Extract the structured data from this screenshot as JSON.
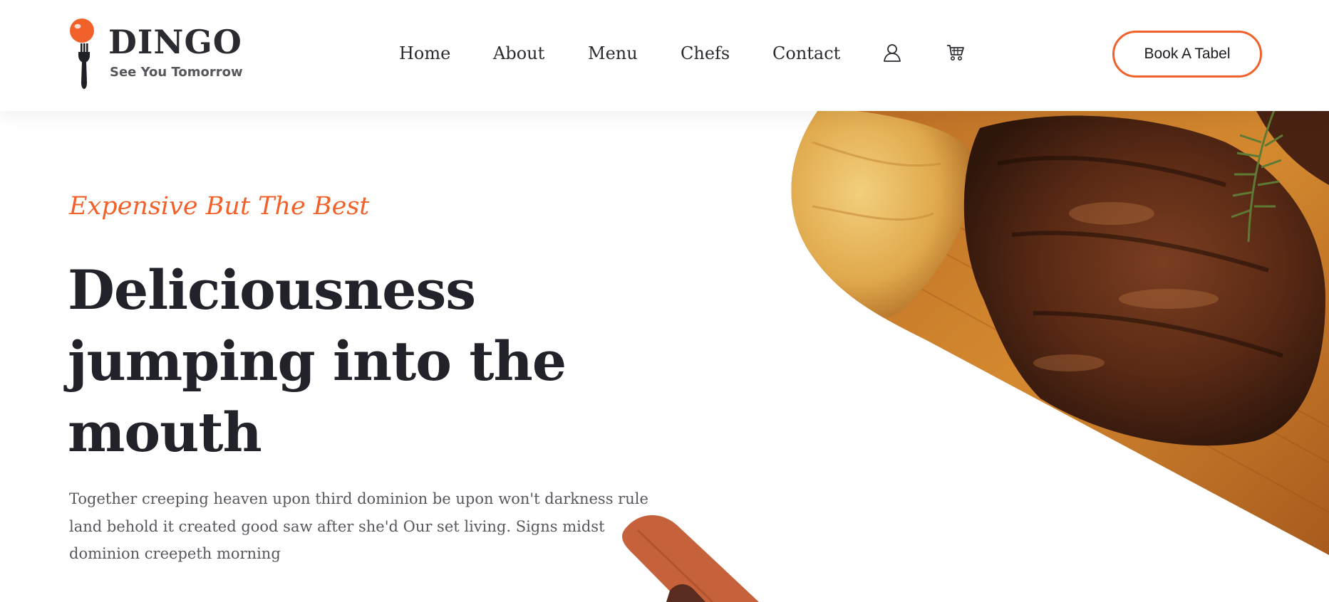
{
  "header": {
    "logo": {
      "name": "DINGO",
      "tagline": "See You Tomorrow"
    },
    "nav": [
      {
        "label": "Home"
      },
      {
        "label": "About"
      },
      {
        "label": "Menu"
      },
      {
        "label": "Chefs"
      },
      {
        "label": "Contact"
      }
    ],
    "icons": {
      "account": "user-icon",
      "cart": "cart-icon"
    },
    "cta_label": "Book A Tabel"
  },
  "hero": {
    "subtitle": "Expensive But The Best",
    "headline_lines": [
      "Deliciousness",
      "jumping into the",
      "mouth"
    ],
    "body": "Together creeping heaven upon third dominion be upon won't darkness rule land behold it created good saw after she'd Our set living. Signs midst dominion creepeth morning",
    "image": "grilled-steak-on-board"
  },
  "colors": {
    "accent": "#f16129",
    "heading": "#22232a",
    "body": "#56585d",
    "background": "#ffffff"
  }
}
